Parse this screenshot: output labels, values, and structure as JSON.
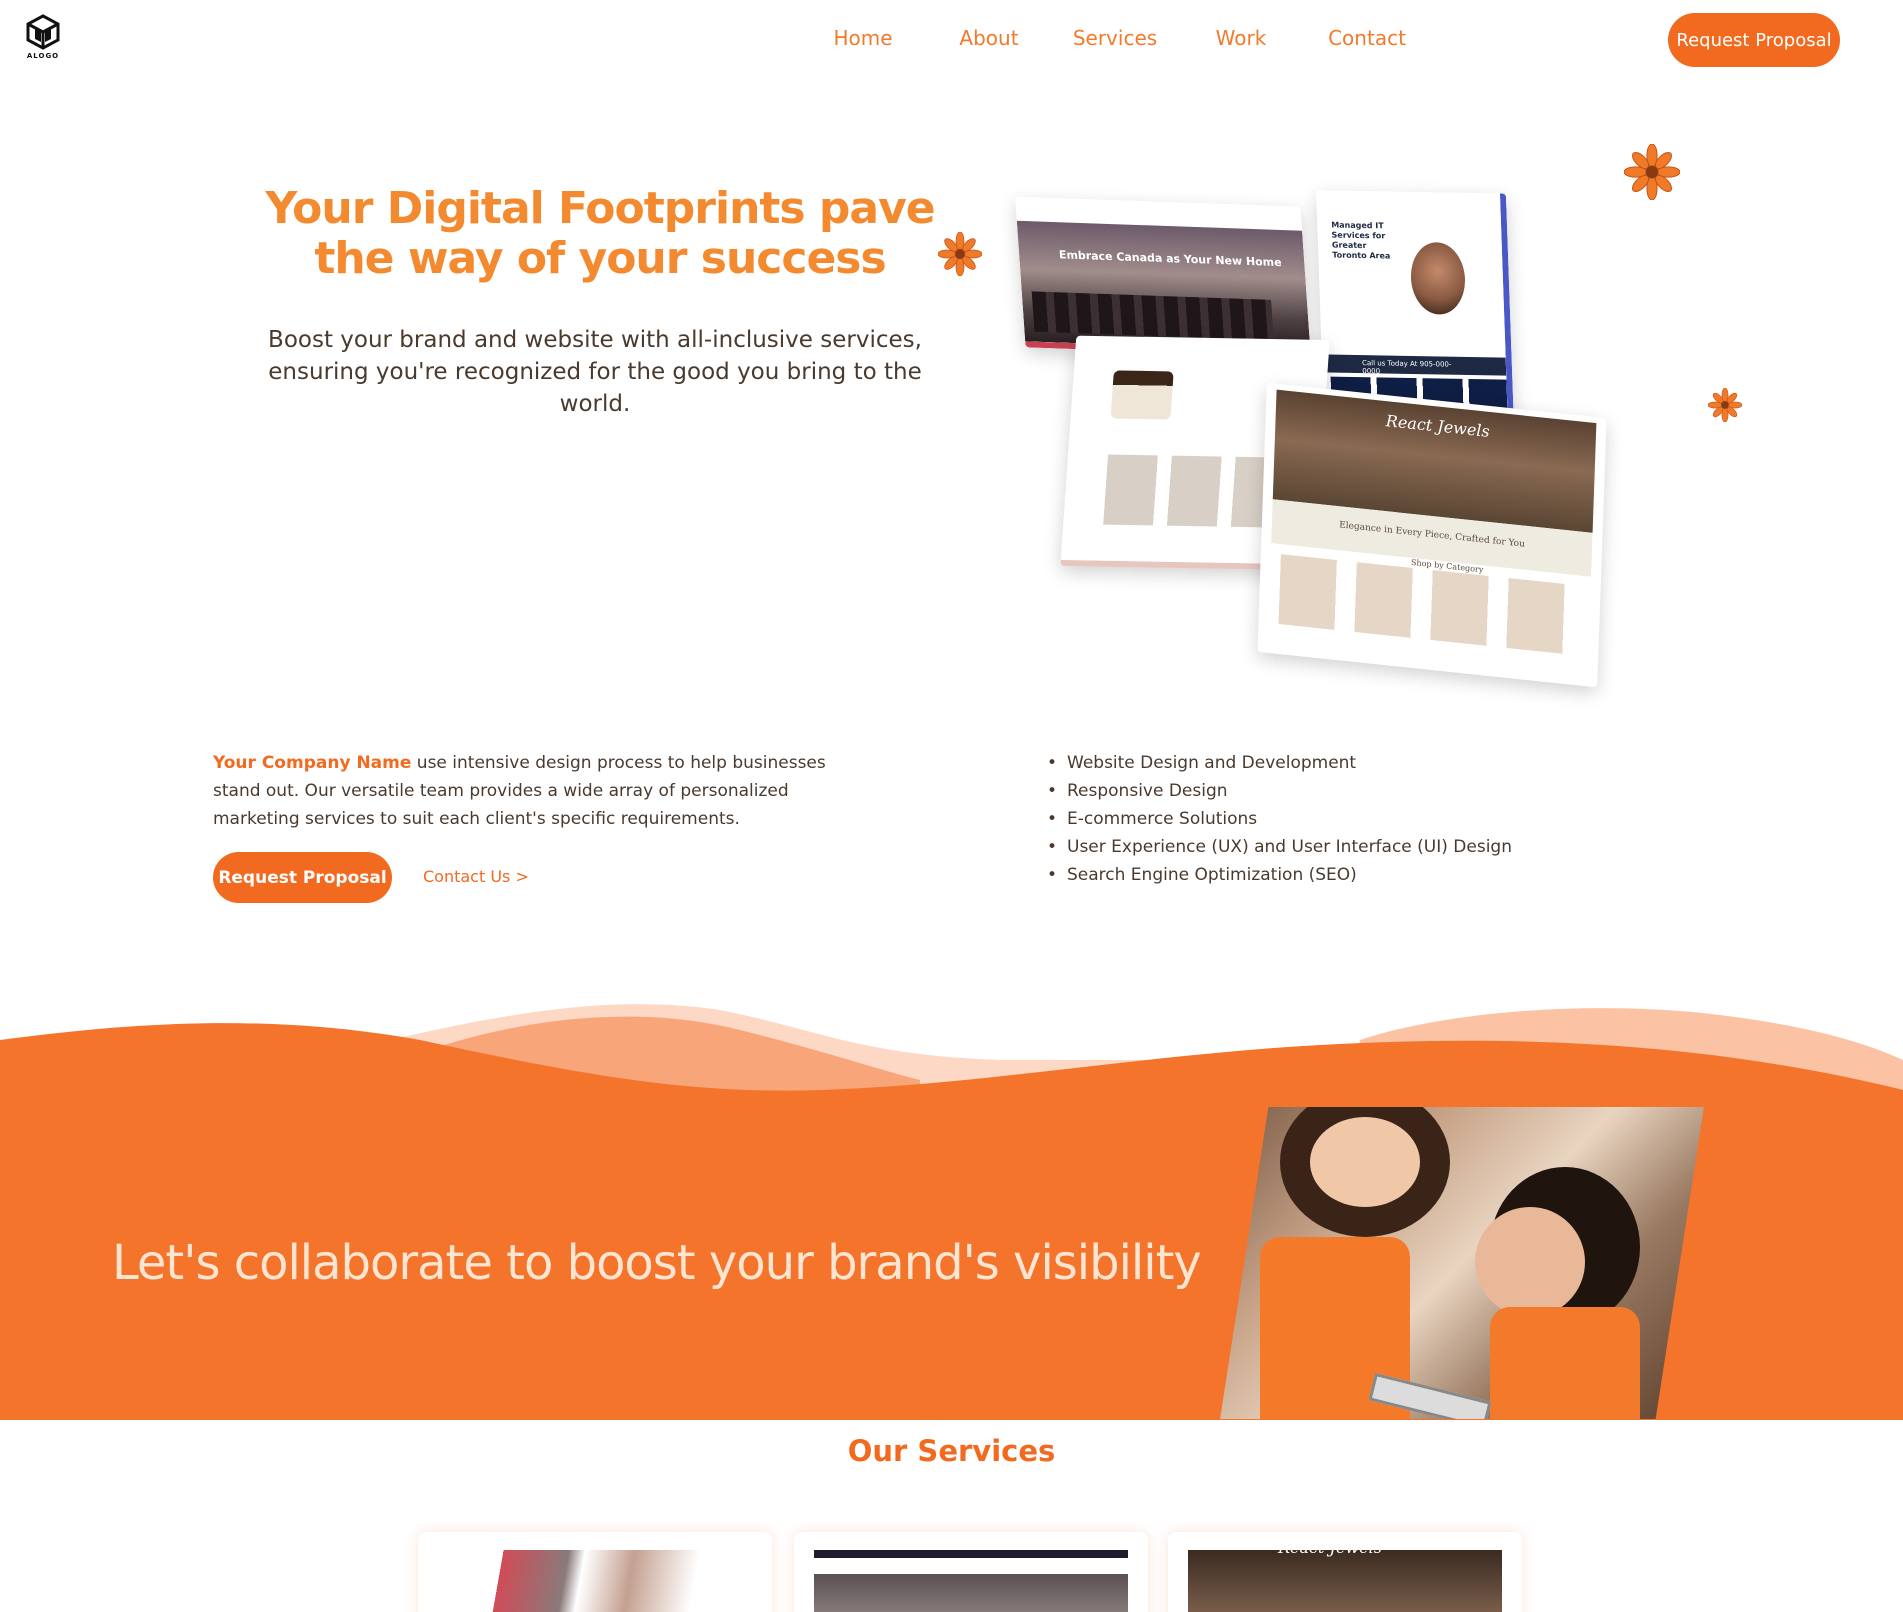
{
  "header": {
    "logo_text": "ALOGO",
    "nav": [
      "Home",
      "About",
      "Services",
      "Work",
      "Contact"
    ],
    "cta_label": "Request Proposal"
  },
  "hero": {
    "title": "Your Digital Footprints pave the way of your success",
    "subtitle": "Boost your brand and website with all-inclusive services, ensuring you're recognized for the good you bring to the world."
  },
  "mockups": {
    "canada_caption": "Embrace Canada as Your New Home",
    "it_caption": "Managed IT Services for Greater Toronto Area",
    "it_bar": "Call us Today At 905-000-0000",
    "jewels_brand": "React Jewels",
    "jewels_tagline": "Elegance in Every Piece, Crafted for You",
    "jewels_category": "Shop by Category"
  },
  "about": {
    "company": "Your Company Name",
    "body": " use intensive design process to help businesses stand out. Our versatile team provides a wide array of personalized marketing services to suit each client's specific requirements.",
    "cta_label": "Request  Proposal",
    "contact_link": "Contact Us >",
    "services": [
      "Website Design and Development",
      "Responsive Design",
      "E-commerce Solutions",
      "User Experience (UX) and User Interface (UI) Design",
      "Search Engine Optimization (SEO)"
    ]
  },
  "band": {
    "title": "Let's collaborate to boost your brand's visibility"
  },
  "our_services": {
    "title": "Our Services",
    "card_3_brand": "React Jewels"
  },
  "colors": {
    "accent": "#f26a1f",
    "title_orange": "#f38a2f",
    "band": "#f4742b",
    "band_light": "#f8a57a",
    "band_pale": "#fdd8c4",
    "text": "#4a3a2e"
  }
}
